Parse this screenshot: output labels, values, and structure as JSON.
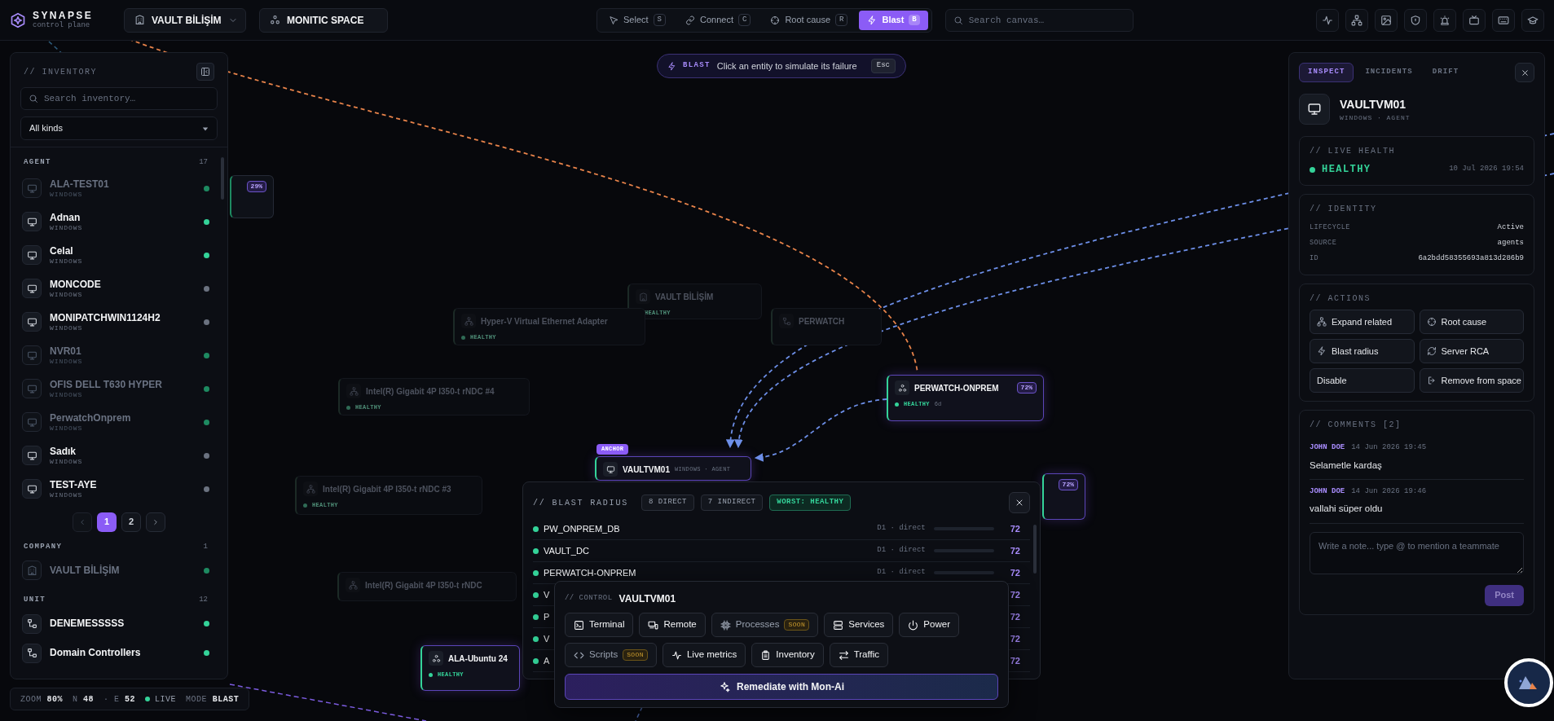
{
  "app": {
    "name": "SYNAPSE",
    "subtitle": "control plane"
  },
  "top_bar": {
    "org_selector": "VAULT BİLİŞİM",
    "space_selector": "MONITIC SPACE",
    "modes": [
      {
        "kind": "select",
        "label": "Select",
        "key": "S",
        "selected": false
      },
      {
        "kind": "connect",
        "label": "Connect",
        "key": "C",
        "selected": false
      },
      {
        "kind": "root_cause",
        "label": "Root cause",
        "key": "R",
        "selected": false
      },
      {
        "kind": "blast",
        "label": "Blast",
        "key": "B",
        "selected": true
      }
    ],
    "search": {
      "placeholder": "Search canvas…"
    }
  },
  "blast_hint": {
    "label": "BLAST",
    "text": "Click an entity to simulate its failure",
    "key": "Esc"
  },
  "inventory": {
    "title": "// INVENTORY",
    "search": {
      "placeholder": "Search inventory…"
    },
    "kind_filter": "All kinds",
    "groups": [
      {
        "name": "AGENT",
        "count": "17",
        "items": [
          {
            "kind": "agent",
            "name": "ALA-TEST01",
            "type": "WINDOWS",
            "dimmed": true,
            "color": "#1e8a61"
          },
          {
            "kind": "agent",
            "name": "Adnan",
            "type": "WINDOWS",
            "dimmed": false,
            "color": "#34d399"
          },
          {
            "kind": "agent",
            "name": "Celal",
            "type": "WINDOWS",
            "dimmed": false,
            "color": "#34d399"
          },
          {
            "kind": "agent",
            "name": "MONCODE",
            "type": "WINDOWS",
            "dimmed": false,
            "color": "#6b7280"
          },
          {
            "kind": "agent",
            "name": "MONIPATCHWIN1124H2",
            "type": "WINDOWS",
            "dimmed": false,
            "color": "#6b7280"
          },
          {
            "kind": "agent",
            "name": "NVR01",
            "type": "WINDOWS",
            "dimmed": true,
            "color": "#1e8a61"
          },
          {
            "kind": "agent",
            "name": "OFIS DELL T630 HYPER",
            "type": "WINDOWS",
            "dimmed": true,
            "color": "#1e8a61"
          },
          {
            "kind": "agent",
            "name": "PerwatchOnprem",
            "type": "WINDOWS",
            "dimmed": true,
            "color": "#1e8a61"
          },
          {
            "kind": "agent",
            "name": "Sadık",
            "type": "WINDOWS",
            "dimmed": false,
            "color": "#6b7280"
          },
          {
            "kind": "agent",
            "name": "TEST-AYE",
            "type": "WINDOWS",
            "dimmed": false,
            "color": "#6b7280"
          }
        ],
        "pages": [
          {
            "label": "1",
            "selected": true
          },
          {
            "label": "2",
            "selected": false
          }
        ]
      },
      {
        "name": "COMPANY",
        "count": "1",
        "items": [
          {
            "kind": "company",
            "name": "VAULT BİLİŞİM",
            "dimmed": true,
            "color": "#1e8a61"
          }
        ]
      },
      {
        "name": "UNIT",
        "count": "12",
        "items": [
          {
            "kind": "unit",
            "name": "DENEMESSSSS",
            "dimmed": false,
            "color": "#34d399"
          },
          {
            "kind": "unit",
            "name": "Domain Controllers",
            "dimmed": false,
            "color": "#34d399"
          }
        ]
      }
    ]
  },
  "status_bar": [
    {
      "kind": "stat",
      "label": "ZOOM",
      "value": "80%"
    },
    {
      "kind": "stat",
      "label": "N",
      "value": "48"
    },
    {
      "kind": "stat",
      "label": "· E",
      "value": "52"
    },
    {
      "kind": "live",
      "label": "LIVE"
    },
    {
      "kind": "stat",
      "label": "MODE",
      "value": "BLAST"
    }
  ],
  "canvas_nodes": [
    {
      "badge": "29%",
      "faded": false,
      "highlighted": false
    },
    {
      "kind": "company",
      "name": "VAULT BİLİŞİM",
      "health": "HEALTHY",
      "faded": true,
      "highlighted": false
    },
    {
      "kind": "adapter",
      "name": "Hyper-V Virtual Ethernet Adapter",
      "health": "HEALTHY",
      "faded": true,
      "highlighted": false
    },
    {
      "kind": "unit",
      "name": "PERWATCH",
      "faded": true,
      "highlighted": false
    },
    {
      "kind": "adapter",
      "name": "Intel(R) Gigabit 4P I350-t rNDC #4",
      "health": "HEALTHY",
      "faded": true,
      "highlighted": false
    },
    {
      "kind": "adapter",
      "name": "Intel(R) Gigabit 4P I350-t rNDC #3",
      "health": "HEALTHY",
      "faded": true,
      "highlighted": false
    },
    {
      "kind": "adapter",
      "name": "Intel(R) Gigabit 4P I350-t rNDC",
      "faded": true,
      "highlighted": false
    },
    {
      "kind": "cluster",
      "name": "PERWATCH-ONPREM",
      "badge": "72%",
      "health": "HEALTHY",
      "age": "6d",
      "faded": false,
      "highlighted": true
    },
    {
      "kind": "agent",
      "name": "VAULTVM01",
      "subtitle": "WINDOWS · AGENT",
      "tag": "ANCHOR",
      "faded": false,
      "highlighted": true
    },
    {
      "badge": "72%",
      "faded": false,
      "highlighted": true
    },
    {
      "kind": "cluster",
      "name": "ALA-Ubuntu 24",
      "health": "HEALTHY",
      "faded": false,
      "highlighted": true
    }
  ],
  "blast_panel": {
    "title": "// BLAST RADIUS",
    "chips": [
      {
        "kind": "count",
        "label": "8 DIRECT"
      },
      {
        "kind": "count",
        "label": "7 INDIRECT"
      },
      {
        "kind": "worst",
        "label": "WORST: HEALTHY"
      }
    ],
    "rows": [
      {
        "name": "PW_ONPREM_DB",
        "distance": "D1 · direct",
        "score": "72"
      },
      {
        "name": "VAULT_DC",
        "distance": "D1 · direct",
        "score": "72"
      },
      {
        "name": "PERWATCH-ONPREM",
        "distance": "D1 · direct",
        "score": "72"
      },
      {
        "name": "V",
        "score": "72"
      },
      {
        "name": "P",
        "score": "72"
      },
      {
        "name": "V",
        "score": "72"
      },
      {
        "name": "A",
        "score": "72"
      }
    ]
  },
  "control_panel": {
    "title": "// CONTROL",
    "target": "VAULTVM01",
    "buttons": [
      {
        "kind": "terminal",
        "label": "Terminal",
        "disabled": false
      },
      {
        "kind": "remote",
        "label": "Remote",
        "disabled": false
      },
      {
        "kind": "processes",
        "label": "Processes",
        "badge": "SOON",
        "disabled": true
      },
      {
        "kind": "services",
        "label": "Services",
        "disabled": false
      },
      {
        "kind": "power",
        "label": "Power",
        "disabled": false
      },
      {
        "kind": "scripts",
        "label": "Scripts",
        "badge": "SOON",
        "disabled": true
      },
      {
        "kind": "metrics",
        "label": "Live metrics",
        "disabled": false
      },
      {
        "kind": "inventory",
        "label": "Inventory",
        "disabled": false
      },
      {
        "kind": "traffic",
        "label": "Traffic",
        "disabled": false
      }
    ],
    "remediate": "Remediate with Mon-Ai"
  },
  "inspector": {
    "tabs": [
      {
        "label": "INSPECT",
        "selected": true
      },
      {
        "label": "INCIDENTS",
        "selected": false
      },
      {
        "label": "DRIFT",
        "selected": false
      }
    ],
    "entity": {
      "kind": "agent",
      "name": "VAULTVM01",
      "subtitle": "WINDOWS · AGENT"
    },
    "live_health": {
      "title": "// LIVE HEALTH",
      "status": "HEALTHY",
      "color": "#34d399",
      "time": "10 Jul 2026 19:54"
    },
    "identity": {
      "title": "// IDENTITY",
      "fields": [
        {
          "label": "LIFECYCLE",
          "value": "Active"
        },
        {
          "label": "SOURCE",
          "value": "agents"
        },
        {
          "label": "ID",
          "value": "6a2bdd58355693a813d286b9"
        }
      ]
    },
    "actions": {
      "title": "// ACTIONS",
      "buttons": [
        {
          "kind": "expand",
          "label": "Expand related"
        },
        {
          "kind": "root_cause",
          "label": "Root cause"
        },
        {
          "kind": "blast",
          "label": "Blast radius"
        },
        {
          "kind": "refresh",
          "label": "Server RCA"
        },
        {
          "kind": "plain",
          "label": "Disable"
        },
        {
          "kind": "remove",
          "label": "Remove from space"
        }
      ]
    },
    "comments": {
      "title": "// COMMENTS [2]",
      "items": [
        {
          "author": "JOHN DOE",
          "time": "14 Jun 2026 19:45",
          "text": "Selametle kardaş"
        },
        {
          "author": "JOHN DOE",
          "time": "14 Jun 2026 19:46",
          "text": "vallahi süper oldu"
        }
      ],
      "placeholder": "Write a note... type @ to mention a teammate",
      "post": {
        "label": "Post",
        "disabled": true
      }
    }
  }
}
